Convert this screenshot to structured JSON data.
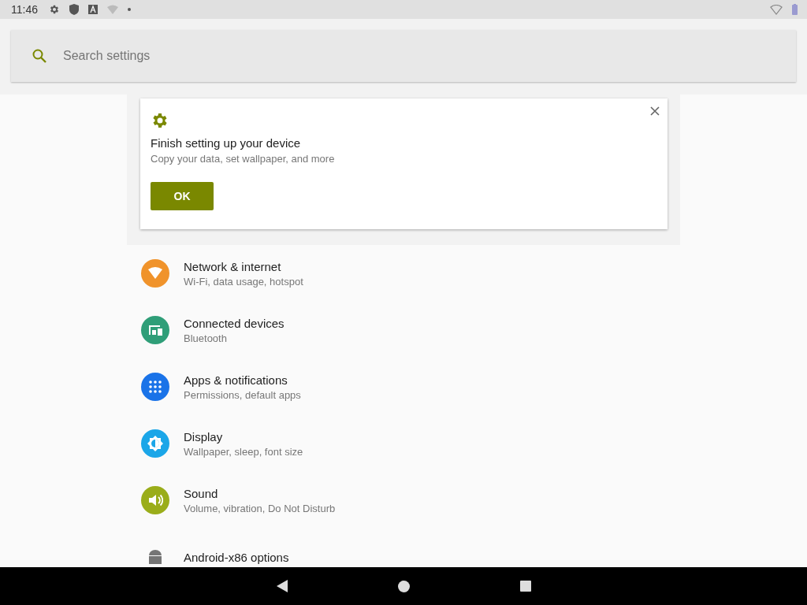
{
  "status_bar": {
    "time": "11:46"
  },
  "search": {
    "placeholder": "Search settings"
  },
  "suggestion": {
    "title": "Finish setting up your device",
    "subtitle": "Copy your data, set wallpaper, and more",
    "button": "OK"
  },
  "settings": [
    {
      "kind": "wifi",
      "color": "#f0932b",
      "title": "Network & internet",
      "subtitle": "Wi-Fi, data usage, hotspot"
    },
    {
      "kind": "devices",
      "color": "#2f9e78",
      "title": "Connected devices",
      "subtitle": "Bluetooth"
    },
    {
      "kind": "apps",
      "color": "#1a73e8",
      "title": "Apps & notifications",
      "subtitle": "Permissions, default apps"
    },
    {
      "kind": "display",
      "color": "#1ba6e8",
      "title": "Display",
      "subtitle": "Wallpaper, sleep, font size"
    },
    {
      "kind": "sound",
      "color": "#9aad1a",
      "title": "Sound",
      "subtitle": "Volume, vibration, Do Not Disturb"
    },
    {
      "kind": "android",
      "color": "#757575",
      "title": "Android-x86 options"
    }
  ]
}
